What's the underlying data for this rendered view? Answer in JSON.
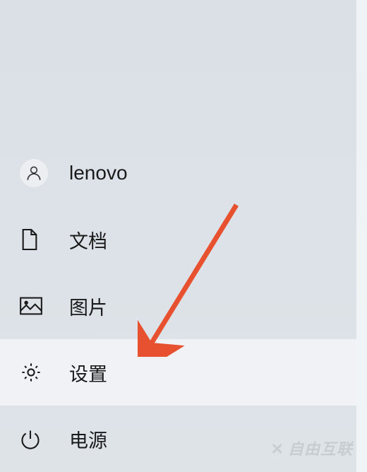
{
  "menu": {
    "user": {
      "label": "lenovo"
    },
    "items": [
      {
        "label": "文档"
      },
      {
        "label": "图片"
      },
      {
        "label": "设置"
      },
      {
        "label": "电源"
      }
    ]
  },
  "watermark": "自由互联"
}
